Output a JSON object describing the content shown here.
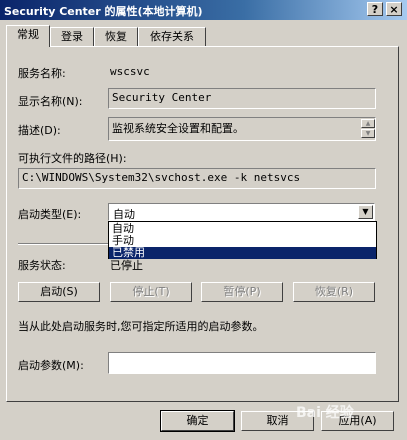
{
  "window": {
    "title": "Security Center 的属性(本地计算机)",
    "help_button": "?",
    "close_button": "×"
  },
  "tabs": [
    {
      "label": "常规",
      "active": true
    },
    {
      "label": "登录",
      "active": false
    },
    {
      "label": "恢复",
      "active": false
    },
    {
      "label": "依存关系",
      "active": false
    }
  ],
  "general": {
    "service_name_label": "服务名称:",
    "service_name_value": "wscsvc",
    "display_name_label": "显示名称(N):",
    "display_name_value": "Security Center",
    "description_label": "描述(D):",
    "description_value": "监视系统安全设置和配置。",
    "exe_path_label": "可执行文件的路径(H):",
    "exe_path_value": "C:\\WINDOWS\\System32\\svchost.exe -k netsvcs",
    "startup_type_label": "启动类型(E):",
    "startup_type_value": "自动",
    "startup_options": [
      "自动",
      "手动",
      "已禁用"
    ],
    "startup_selected_index": 2,
    "service_status_label": "服务状态:",
    "service_status_value": "已停止",
    "start_button": "启动(S)",
    "stop_button": "停止(T)",
    "pause_button": "暂停(P)",
    "resume_button": "恢复(R)",
    "hint_text": "当从此处启动服务时,您可指定所适用的启动参数。",
    "start_params_label": "启动参数(M):",
    "start_params_value": ""
  },
  "footer": {
    "ok_button": "确定",
    "cancel_button": "取消",
    "apply_button": "应用(A)"
  },
  "watermark_text": "Bai 经验"
}
